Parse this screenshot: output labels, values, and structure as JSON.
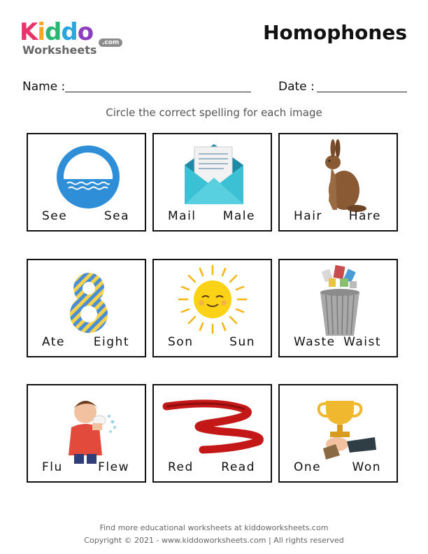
{
  "logo": {
    "letters": [
      "K",
      "i",
      "d",
      "d",
      "o"
    ],
    "letter_colors": [
      "#e8336d",
      "#f5a623",
      "#2bb673",
      "#2aa5e0",
      "#8e3fbf"
    ],
    "worksheets": "Worksheets",
    "com": ".com"
  },
  "title": "Homophones",
  "fields": {
    "name_label": "Name :",
    "date_label": "Date :"
  },
  "instruction": "Circle the correct spelling for each image",
  "cards": [
    {
      "image": "sea-icon",
      "left": "See",
      "right": "Sea"
    },
    {
      "image": "mail-icon",
      "left": "Mail",
      "right": "Male"
    },
    {
      "image": "hare-icon",
      "left": "Hair",
      "right": "Hare"
    },
    {
      "image": "eight-icon",
      "left": "Ate",
      "right": "Eight"
    },
    {
      "image": "sun-icon",
      "left": "Son",
      "right": "Sun"
    },
    {
      "image": "waste-bin-icon",
      "left": "Waste",
      "right": "Waist"
    },
    {
      "image": "sneezing-boy-icon",
      "left": "Flu",
      "right": "Flew"
    },
    {
      "image": "red-ribbon-icon",
      "left": "Red",
      "right": "Read"
    },
    {
      "image": "trophy-icon",
      "left": "One",
      "right": "Won"
    }
  ],
  "footer": {
    "line1": "Find more educational worksheets at kiddoworksheets.com",
    "line2": "Copyright © 2021 - www.kiddoworksheets.com  |  All rights reserved"
  }
}
